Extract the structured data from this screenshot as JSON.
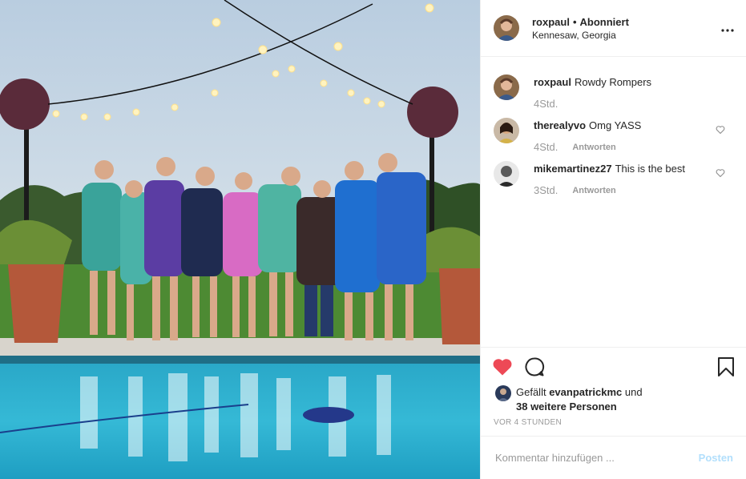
{
  "post": {
    "author": "roxpaul",
    "separator": "•",
    "follow_label": "Abonniert",
    "location": "Kennesaw, Georgia",
    "more_icon": "more-horizontal-icon"
  },
  "comments": [
    {
      "user": "roxpaul",
      "text": "Rowdy Rompers",
      "time": "4Std.",
      "reply": ""
    },
    {
      "user": "therealyvo",
      "text": "Omg YASS",
      "time": "4Std.",
      "reply": "Antworten"
    },
    {
      "user": "mikemartinez27",
      "text": "This is the best",
      "time": "3Std.",
      "reply": "Antworten"
    }
  ],
  "actions": {
    "like_icon": "heart-filled-icon",
    "comment_icon": "comment-icon",
    "save_icon": "bookmark-icon",
    "like_color": "#ed4956"
  },
  "likes": {
    "prefix": "Gefällt",
    "user": "evanpatrickmc",
    "connector": "und",
    "others": "38 weitere Personen"
  },
  "timestamp": "VOR 4 STUNDEN",
  "composer": {
    "placeholder": "Kommentar hinzufügen ...",
    "post_label": "Posten"
  }
}
